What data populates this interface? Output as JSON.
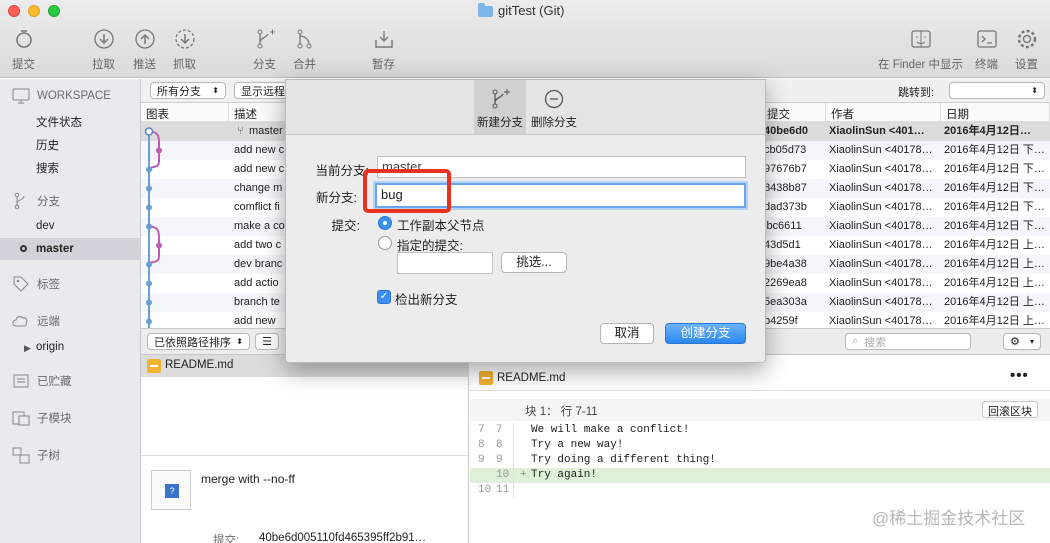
{
  "window": {
    "title": "gitTest (Git)"
  },
  "toolbar": {
    "commit": "提交",
    "pull": "拉取",
    "push": "推送",
    "fetch": "抓取",
    "branch": "分支",
    "merge": "合并",
    "stash": "暂存",
    "finder": "在 Finder 中显示",
    "terminal": "终端",
    "settings": "设置"
  },
  "sidebar": {
    "workspace": "WORKSPACE",
    "file_status": "文件状态",
    "history": "历史",
    "search": "搜索",
    "branches": "分支",
    "branch_dev": "dev",
    "branch_master": "master",
    "tags": "标签",
    "remotes": "远端",
    "origin": "origin",
    "stashes": "已贮藏",
    "submodules": "子模块",
    "subtrees": "子树"
  },
  "filter": {
    "all_branches": "所有分支",
    "show_remote": "显示远程",
    "jump_to": "跳转到:"
  },
  "columns": {
    "graph": "图表",
    "description": "描述",
    "commit": "提交",
    "author": "作者",
    "date": "日期"
  },
  "commits": [
    {
      "desc": "master",
      "hash": "40be6d0",
      "author": "XiaolinSun <401…",
      "date": "2016年4月12日…"
    },
    {
      "desc": "add new c",
      "hash": "cb05d73",
      "author": "XiaolinSun <40178…",
      "date": "2016年4月12日 下…"
    },
    {
      "desc": "add new c",
      "hash": "97676b7",
      "author": "XiaolinSun <40178…",
      "date": "2016年4月12日 下…"
    },
    {
      "desc": "change m",
      "hash": "8438b87",
      "author": "XiaolinSun <40178…",
      "date": "2016年4月12日 下…"
    },
    {
      "desc": "comflict fi",
      "hash": "dad373b",
      "author": "XiaolinSun <40178…",
      "date": "2016年4月12日 下…"
    },
    {
      "desc": "make a co",
      "hash": "lbc6611",
      "author": "XiaolinSun <40178…",
      "date": "2016年4月12日 下…"
    },
    {
      "desc": "add two c",
      "hash": "43d5d1",
      "author": "XiaolinSun <40178…",
      "date": "2016年4月12日 上…"
    },
    {
      "desc": "dev branc",
      "hash": "9be4a38",
      "author": "XiaolinSun <40178…",
      "date": "2016年4月12日 上…"
    },
    {
      "desc": "add actio",
      "hash": "2269ea8",
      "author": "XiaolinSun <40178…",
      "date": "2016年4月12日 上…"
    },
    {
      "desc": "branch te",
      "hash": "5ea303a",
      "author": "XiaolinSun <40178…",
      "date": "2016年4月12日 上…"
    },
    {
      "desc": "add new",
      "hash": "b4259f",
      "author": "XiaolinSun <40178…",
      "date": "2016年4月12日 上…"
    }
  ],
  "bottombar": {
    "sort": "已依照路径排序",
    "search_placeholder": "搜索"
  },
  "files": {
    "name": "README.md",
    "commit_message": "merge with --no-ff",
    "commit_label": "提交:",
    "commit_hash": "40be6d005110fd465395ff2b91…"
  },
  "diff": {
    "filename": "README.md",
    "hunk": "块 1： 行 7-11",
    "revert": "回滚区块",
    "lines": [
      {
        "old": "7",
        "new": "7",
        "sign": "",
        "text": "We will make a conflict!",
        "added": false
      },
      {
        "old": "8",
        "new": "8",
        "sign": "",
        "text": "Try a new way!",
        "added": false
      },
      {
        "old": "9",
        "new": "9",
        "sign": "",
        "text": "Try doing a different thing!",
        "added": false
      },
      {
        "old": "",
        "new": "10",
        "sign": "+",
        "text": "Try again!",
        "added": true
      },
      {
        "old": "10",
        "new": "11",
        "sign": "",
        "text": "",
        "added": false
      }
    ]
  },
  "dialog": {
    "new_branch_tab": "新建分支",
    "delete_branch_tab": "删除分支",
    "current_branch_label": "当前分支:",
    "current_branch_value": "master",
    "new_branch_label": "新分支:",
    "new_branch_value": "bug",
    "commit_label": "提交:",
    "opt_working_copy": "工作副本父节点",
    "opt_specified": "指定的提交:",
    "pick_button": "挑选...",
    "checkout_label": "检出新分支",
    "cancel": "取消",
    "create": "创建分支"
  },
  "watermark": "@稀土掘金技术社区",
  "colors": {
    "accent": "#3b8ff2",
    "highlight": "#e8321f",
    "graph_blue": "#6a9ed6",
    "graph_pink": "#c05bb6"
  }
}
